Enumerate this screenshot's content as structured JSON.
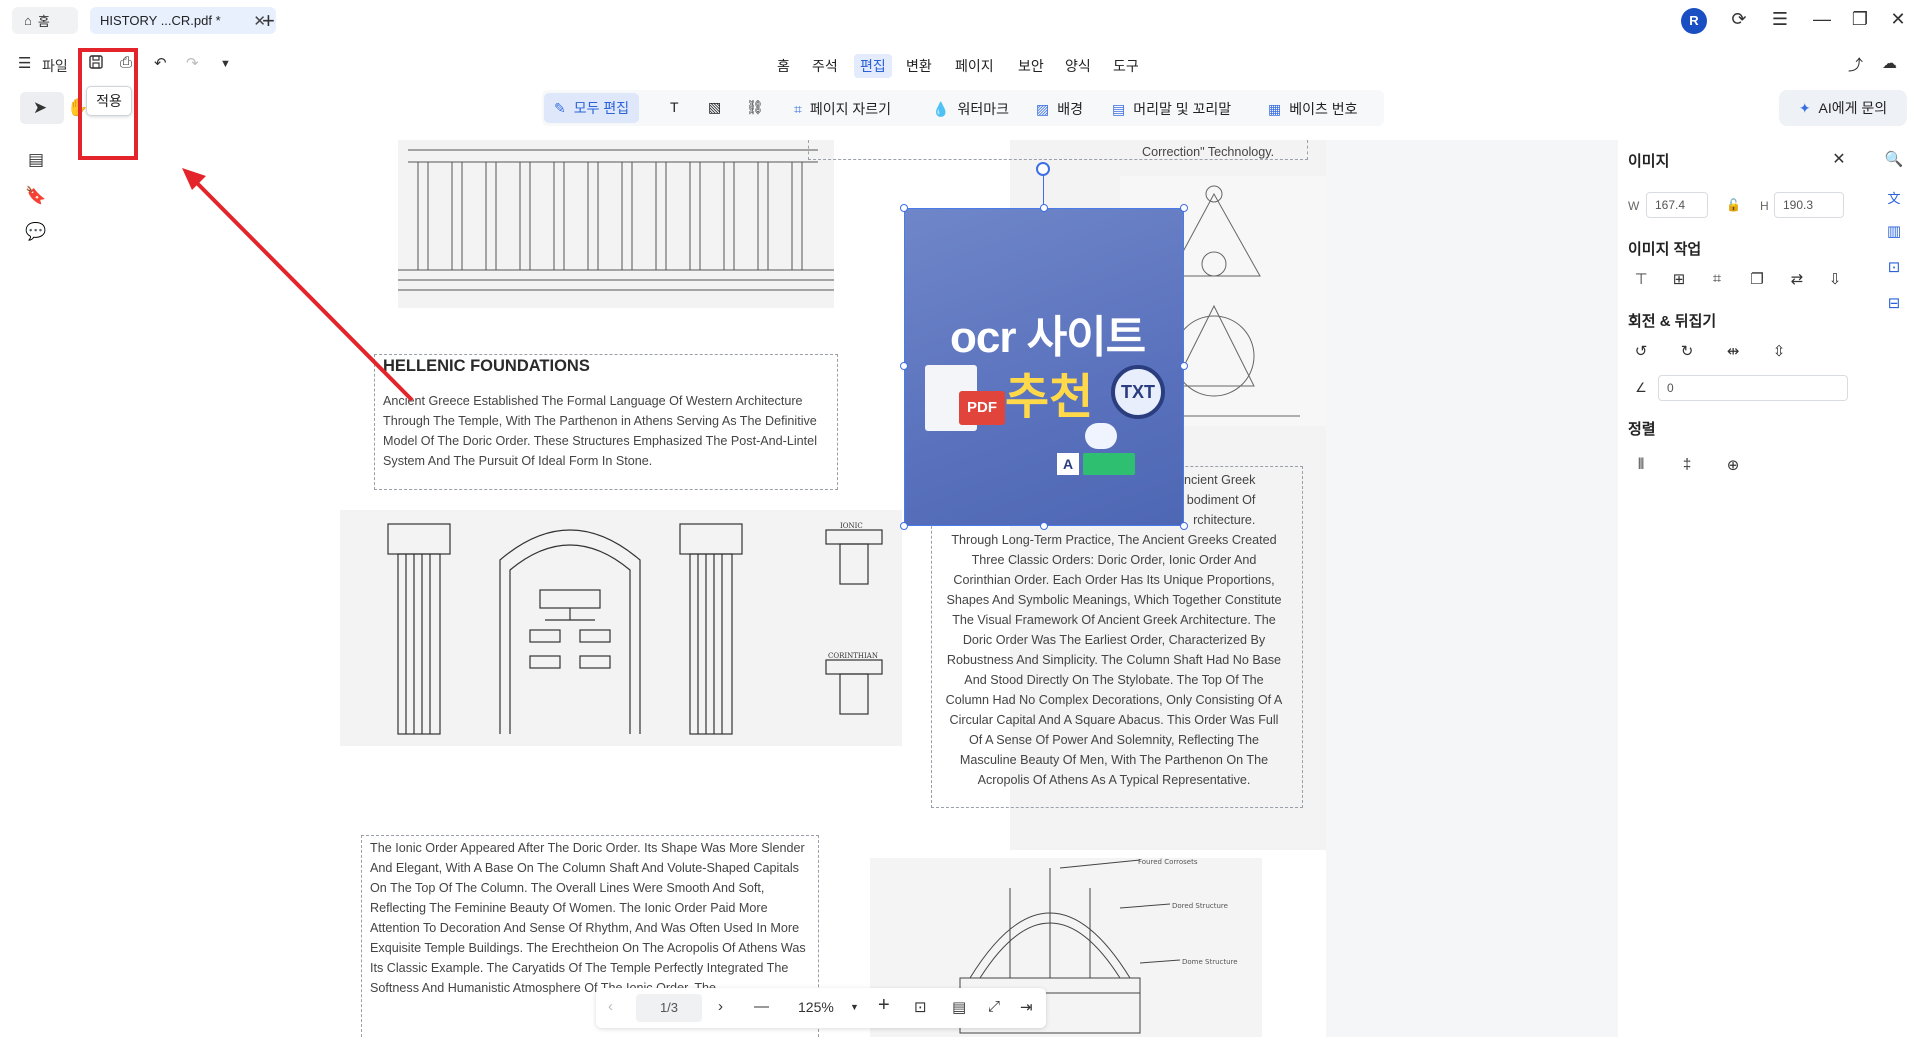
{
  "tabs": {
    "home": "홈",
    "document": "HISTORY ...CR.pdf *",
    "close": "✕",
    "new": "+"
  },
  "window": {
    "avatar": "R"
  },
  "toolbar": {
    "file": "파일",
    "tooltip": "적용"
  },
  "menu": [
    "홈",
    "주석",
    "편집",
    "변환",
    "페이지",
    "보안",
    "양식",
    "도구"
  ],
  "edit_tools": {
    "edit_all": "모두 편집",
    "crop": "페이지 자르기",
    "watermark": "워터마크",
    "background": "배경",
    "header_footer": "머리말 및 꼬리말",
    "bates": "베이츠 번호"
  },
  "ai": {
    "label": "AI에게 문의"
  },
  "document": {
    "correction_text": "Correction\" Technology.",
    "heading": "HELLENIC FOUNDATIONS",
    "para1": "Ancient Greece Established The Formal Language Of Western Architecture Through The Temple, With The Parthenon in Athens Serving As The Definitive Model Of The Doric Order. These Structures Emphasized The Post-And-Lintel System And The Pursuit Of Ideal Form In Stone.",
    "para2_top": "ncient Greek\nbodiment Of\nrchitecture.",
    "para2": "Through Long-Term Practice, The Ancient Greeks Created Three Classic Orders: Doric Order, Ionic Order And Corinthian Order. Each Order Has Its Unique Proportions, Shapes And Symbolic Meanings, Which Together Constitute The Visual Framework Of Ancient Greek Architecture. The Doric Order Was The Earliest Order, Characterized By Robustness And Simplicity. The Column Shaft Had No Base And Stood Directly On The Stylobate. The Top Of The Column Had No Complex Decorations, Only Consisting Of A Circular Capital And A Square Abacus. This Order Was Full Of A Sense Of Power And Solemnity, Reflecting The Masculine Beauty Of Men, With The Parthenon On The Acropolis Of Athens As A Typical Representative.",
    "para3": "The Ionic Order Appeared After The Doric Order. Its Shape Was More Slender And Elegant, With A Base On The Column Shaft And Volute-Shaped Capitals On The Top Of The Column. The Overall Lines Were Smooth And Soft, Reflecting The Feminine Beauty Of Women. The Ionic Order Paid More Attention To Decoration And Sense Of Rhythm, And Was Often Used In More Exquisite Temple Buildings. The Erechtheion On The Acropolis Of Athens Was Its Classic Example. The Caryatids Of The Temple Perfectly Integrated The Softness And Humanistic Atmosphere Of The Ionic Order. The",
    "labels": {
      "ionic": "IONIC",
      "corinthian": "CORINTHIAN"
    },
    "dome_labels": [
      "Foured Corrosets",
      "Dored Structure",
      "Dome Structure"
    ]
  },
  "selected_image": {
    "title": "ocr 사이트",
    "subtitle": "추천",
    "pdf": "PDF",
    "txt": "TXT",
    "a": "A"
  },
  "bottom_bar": {
    "page": "1/3",
    "zoom": "125%"
  },
  "right_panel": {
    "title": "이미지",
    "w_label": "W",
    "w_value": "167.4",
    "h_label": "H",
    "h_value": "190.3",
    "image_actions": "이미지 작업",
    "rotate_flip": "회전 & 뒤집기",
    "angle_value": "0",
    "align": "정렬"
  },
  "colors": {
    "accent": "#2b62d9",
    "annotation": "#e3242b",
    "image_bg": "#5f77c0",
    "highlight": "#ffd94a"
  }
}
